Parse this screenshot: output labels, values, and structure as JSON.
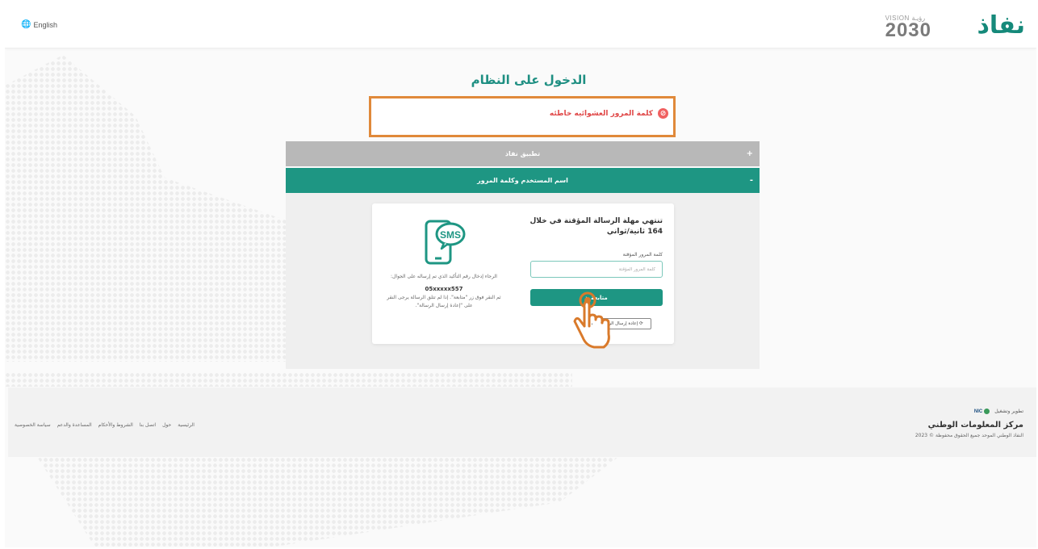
{
  "header": {
    "language_label": "English",
    "vision_small": "VISION",
    "vision_arabic": "رؤيـة",
    "vision_year": "2030",
    "brand": "نفاذ"
  },
  "page": {
    "title": "الدخول على النظام"
  },
  "alert": {
    "message": "كلمة المرور العشوائيه خاطئه"
  },
  "accordion": {
    "nafath_app_label": "تطبيق نفاذ",
    "username_password_label": "اسم المستخدم وكلمة المرور",
    "collapsed_sign": "+",
    "expanded_sign": "-"
  },
  "otp_card": {
    "timer_text": "تنتهي مهلة الرسالة المؤقتة في خلال 164 ثانية/ثواني",
    "field_label": "كلمة المرور المؤقتة",
    "field_placeholder": "كلمة المرور المؤقتة",
    "continue_label": "متابعة",
    "resend_label": "إعادة إرسال الرسالة",
    "sms_badge": "SMS",
    "hint_enter_code": "الرجاء إدخال رقم التأكيد الذي تم إرساله على الجوال:",
    "phone_number": "05xxxxx557",
    "hint_resend": "ثم النقر فوق زر \"متابعة\". إذا لم تتلق الرسالة يرجى النقر على \"إعادة إرسال الرسالة\"."
  },
  "footer": {
    "links": [
      "الرئيسية",
      "حول",
      "اتصل بنا",
      "الشروط والأحكام",
      "المساعدة والدعم",
      "سياسة الخصوصية"
    ],
    "developed_by": "تطوير وتشغيل",
    "nic_abbr": "NIC",
    "center_name": "مركز المعلومات الوطني",
    "copyright": "النفاذ الوطني الموحد جميع الحقوق محفوظة © 2023"
  },
  "colors": {
    "brand_green": "#1e9683",
    "error_red": "#e04848",
    "highlight_orange": "#e0893a"
  }
}
